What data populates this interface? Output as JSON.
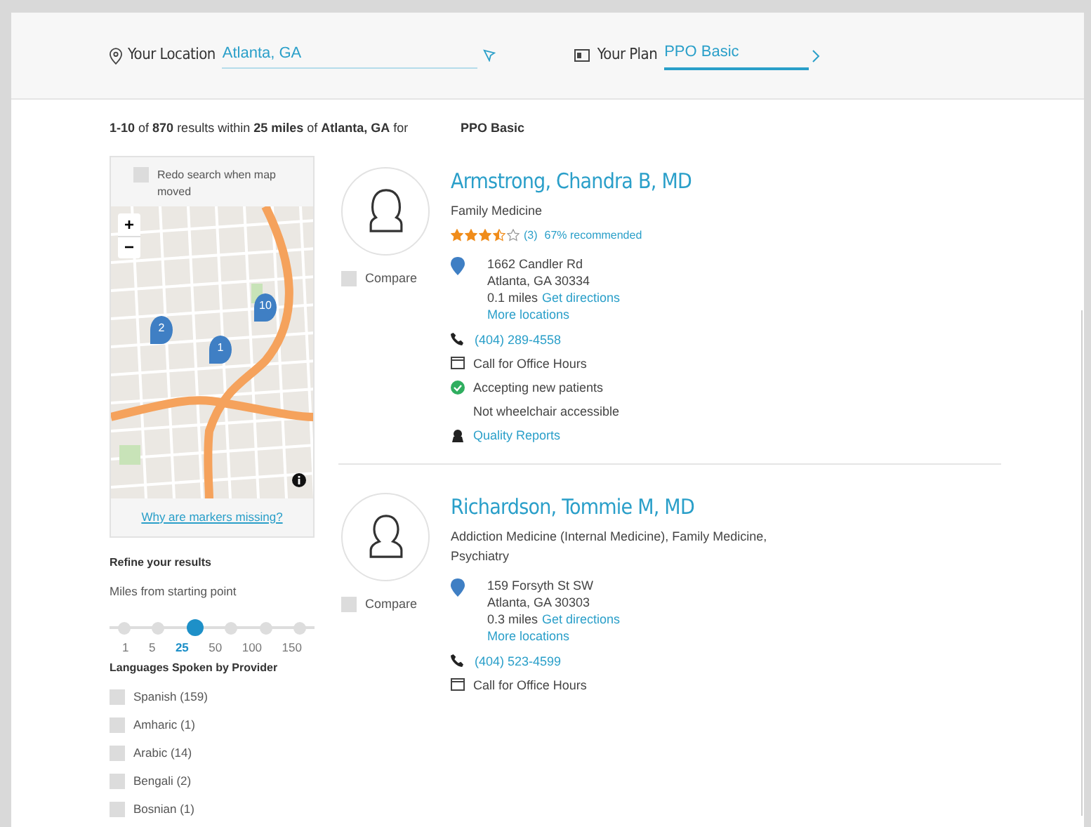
{
  "header": {
    "location": {
      "label": "Your Location",
      "value": "Atlanta, GA"
    },
    "plan": {
      "label": "Your Plan",
      "value": "PPO Basic"
    }
  },
  "summary": {
    "text": "**1-10** of **870** results within **25 miles** of **Atlanta, GA** for",
    "plan": "PPO Basic"
  },
  "map": {
    "redo": {
      "label": "Redo search when map moved",
      "checked": false
    },
    "zoom_in": "+",
    "zoom_out": "−",
    "markers": [
      "2",
      "1",
      "10"
    ],
    "link": "Why are markers missing?"
  },
  "refine": {
    "title": "Refine your results",
    "miles_label": "Miles from starting point",
    "miles": [
      {
        "label": "1",
        "selected": false
      },
      {
        "label": "5",
        "selected": false
      },
      {
        "label": "25",
        "selected": true
      },
      {
        "label": "50",
        "selected": false
      },
      {
        "label": "100",
        "selected": false
      },
      {
        "label": "150",
        "selected": false
      }
    ],
    "languages_title": "Languages Spoken by Provider",
    "languages": [
      {
        "label": "Spanish (159)",
        "checked": false
      },
      {
        "label": "Amharic (1)",
        "checked": false
      },
      {
        "label": "Arabic (14)",
        "checked": false
      },
      {
        "label": "Bengali (2)",
        "checked": false
      },
      {
        "label": "Bosnian (1)",
        "checked": false
      }
    ]
  },
  "providers": [
    {
      "name": "Armstrong, Chandra B, MD",
      "avatar": {
        "kind": "female"
      },
      "specialty": "Family Medicine",
      "stars": 3.5,
      "reviews": "(3)",
      "recommended": "67% recommended",
      "compare": {
        "label": "Compare",
        "checked": false
      },
      "address": [
        "1662 Candler Rd",
        "Atlanta, GA 30334"
      ],
      "distance": "0.1 miles",
      "directions": "Get directions",
      "more": "More locations",
      "phone": "(404) 289-4558",
      "hours": "Call for Office Hours",
      "accepting": {
        "text": "Accepting new patients",
        "on": true
      },
      "wheelchair": "Not wheelchair accessible",
      "quality": "Quality Reports"
    },
    {
      "name": "Richardson, Tommie M, MD",
      "avatar": {
        "kind": "male"
      },
      "specialty": "Addiction Medicine (Internal Medicine), Family Medicine, Psychiatry",
      "compare": {
        "label": "Compare",
        "checked": false
      },
      "address": [
        "159 Forsyth St SW",
        "Atlanta, GA 30303"
      ],
      "distance": "0.3 miles",
      "directions": "Get directions",
      "more": "More locations",
      "phone": "(404) 523-4599",
      "hours": "Call for Office Hours"
    }
  ]
}
